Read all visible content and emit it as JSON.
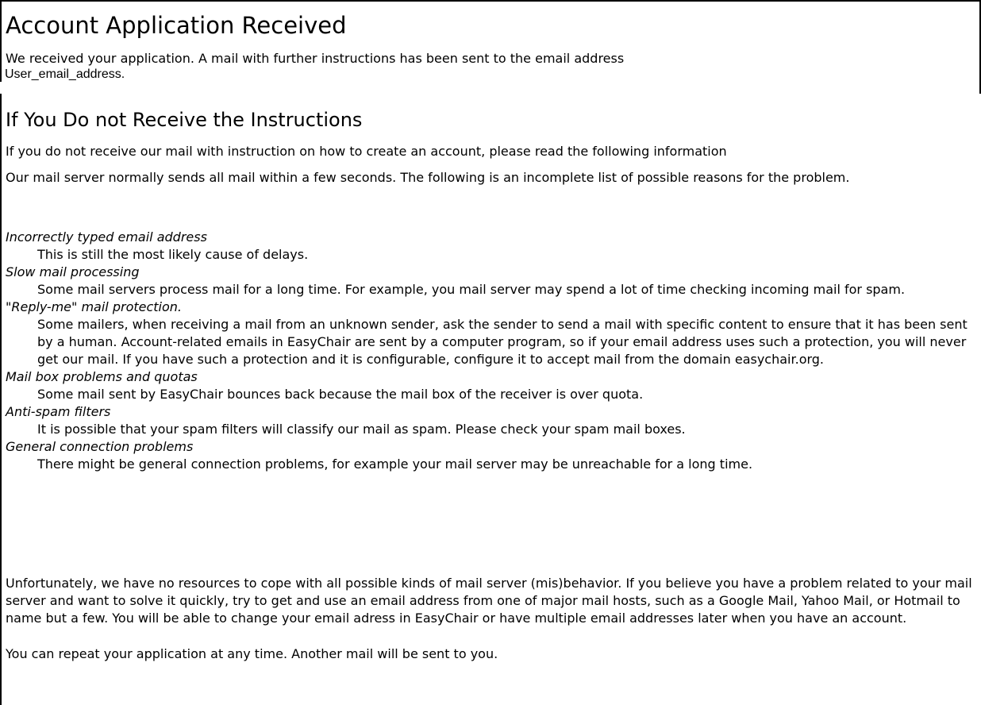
{
  "page": {
    "title": "Account Application Received",
    "intro": "We received your application. A mail with further instructions has been sent to the email address",
    "email": "User_email_address."
  },
  "section": {
    "heading": "If You Do not Receive the Instructions",
    "paragraph1": "If you do not receive our mail with instruction on how to create an account, please read the following information",
    "paragraph2": "Our mail server normally sends all mail within a few seconds. The following is an incomplete list of possible reasons for the problem.",
    "reasons": [
      {
        "term": "Incorrectly typed email address",
        "description": "This is still the most likely cause of delays."
      },
      {
        "term": "Slow mail processing",
        "description": "Some mail servers process mail for a long time. For example, you mail server may spend a lot of time checking incoming mail for spam."
      },
      {
        "term": "\"Reply-me\" mail protection.",
        "description": "Some mailers, when receiving a mail from an unknown sender, ask the sender to send a mail with specific content to ensure that it has been sent by a human. Account-related emails in EasyChair are sent by a computer program, so if your email address uses such a protection, you will never get our mail. If you have such a protection and it is configurable, configure it to accept mail from the domain easychair.org."
      },
      {
        "term": "Mail box problems and quotas",
        "description": "Some mail sent by EasyChair bounces back because the mail box of the receiver is over quota."
      },
      {
        "term": "Anti-spam filters",
        "description": "It is possible that your spam filters will classify our mail as spam. Please check your spam mail boxes."
      },
      {
        "term": "General connection problems",
        "description": "There might be general connection problems, for example your mail server may be unreachable for a long time."
      }
    ],
    "paragraph3": "Unfortunately, we have no resources to cope with all possible kinds of mail server (mis)behavior. If you believe you have a problem related to your mail server and want to solve it quickly, try to get and use an email address from one of major mail hosts, such as a Google Mail, Yahoo Mail, or Hotmail to name but a few. You will be able to change your email adress in EasyChair or have multiple email addresses later when you have an account.",
    "paragraph4": "You can repeat your application at any time. Another mail will be sent to you."
  }
}
